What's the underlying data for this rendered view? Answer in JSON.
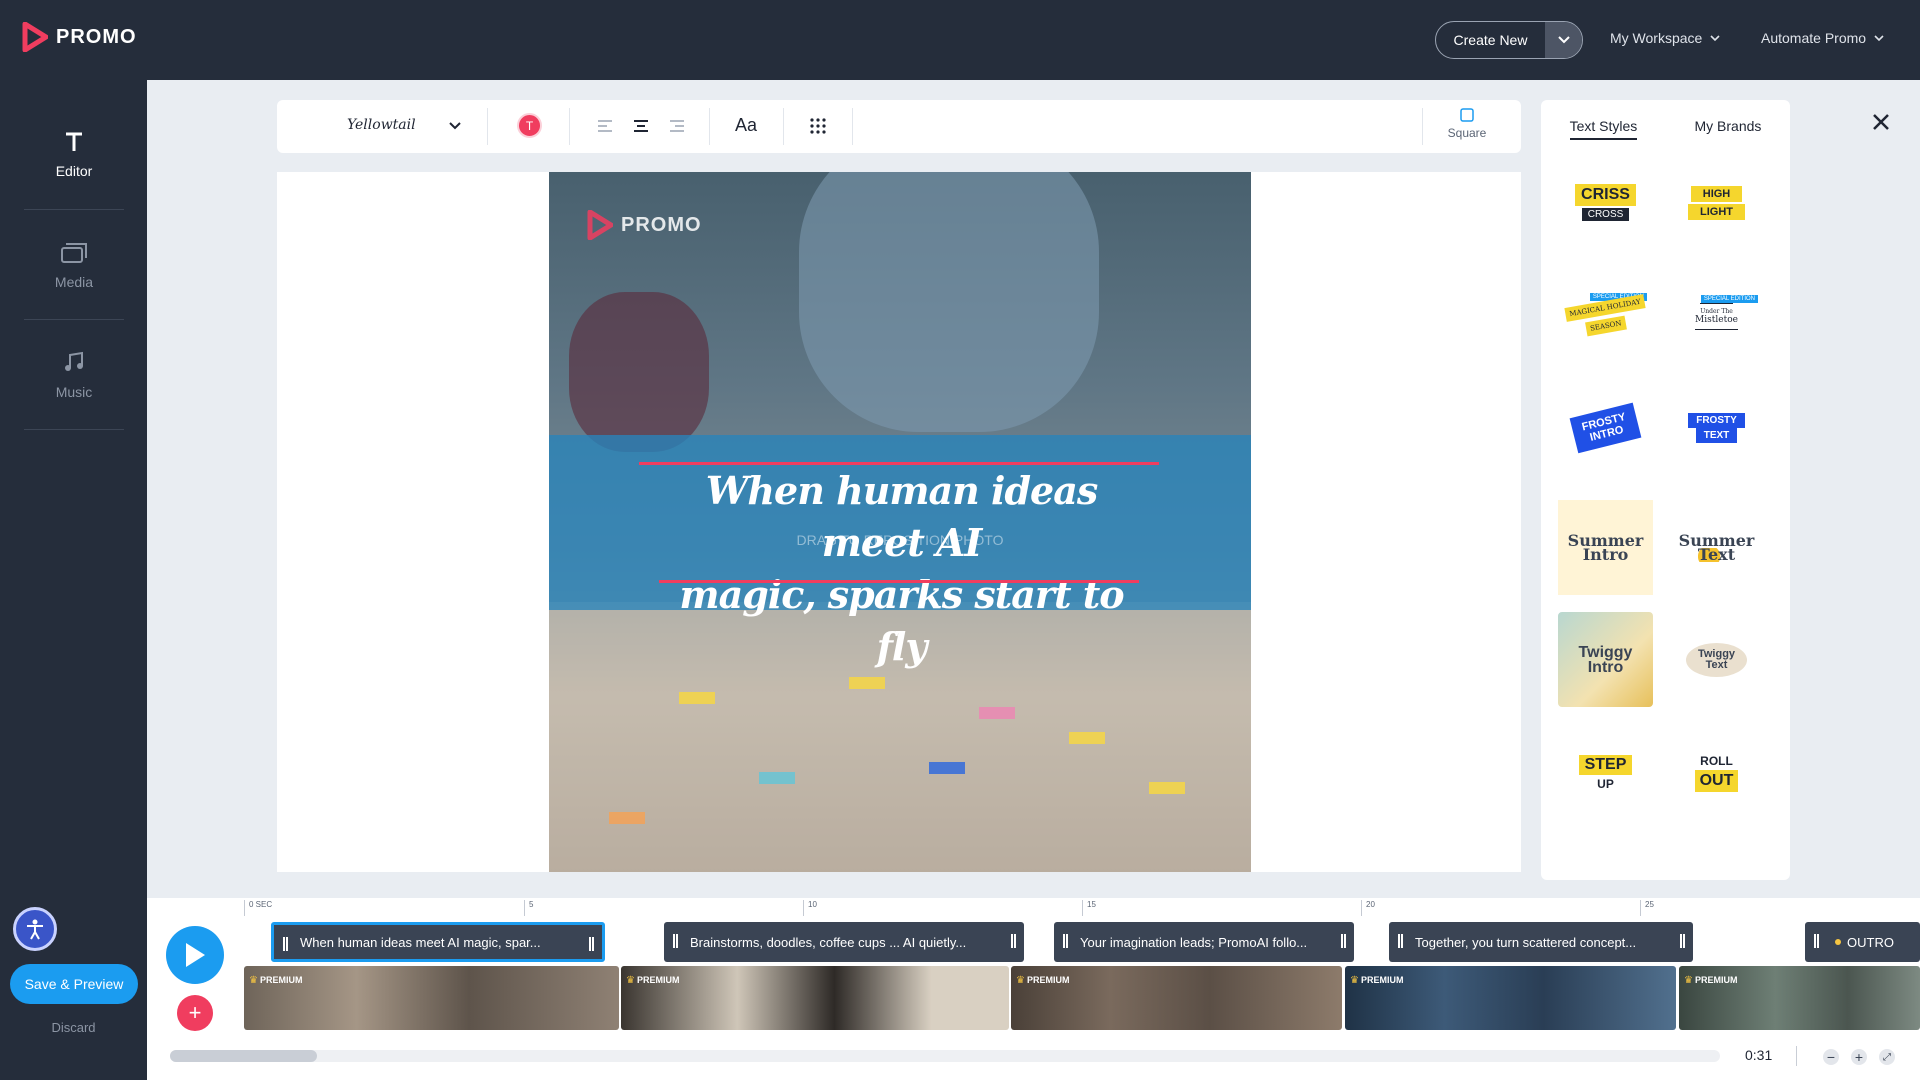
{
  "app": {
    "logo_text": "PROMO"
  },
  "header": {
    "create_new": "Create New",
    "my_workspace": "My Workspace",
    "automate": "Automate Promo"
  },
  "sidebar": {
    "items": [
      {
        "label": "Editor"
      },
      {
        "label": "Media"
      },
      {
        "label": "Music"
      }
    ],
    "save_preview": "Save & Preview",
    "discard": "Discard"
  },
  "toolbar": {
    "font": "Yellowtail",
    "color_letter": "T",
    "case_label": "Aa",
    "aspect_label": "Square"
  },
  "canvas": {
    "logo_text": "PROMO",
    "caption_line1": "When human ideas meet AI",
    "caption_line2": "magic, sparks start to fly",
    "drag_hint": "DRAG TO REPOSITION PHOTO"
  },
  "right_panel": {
    "tabs": [
      "Text Styles",
      "My Brands"
    ],
    "styles": [
      {
        "top": "CRISS",
        "bottom": "CROSS"
      },
      {
        "top": "HIGH",
        "bottom": "LIGHT"
      },
      {
        "top": "MAGICAL HOLIDAY",
        "bottom": "SEASON",
        "tag": "SPECIAL EDITION"
      },
      {
        "top": "Under The",
        "bottom": "Mistletoe",
        "tag": "SPECIAL EDITION"
      },
      {
        "top": "FROSTY",
        "bottom": "INTRO"
      },
      {
        "top": "FROSTY",
        "bottom": "TEXT"
      },
      {
        "top": "Summer",
        "bottom": "Intro"
      },
      {
        "top": "Summer",
        "bottom": "Text"
      },
      {
        "top": "Twiggy",
        "bottom": "Intro"
      },
      {
        "top": "Twiggy",
        "bottom": "Text"
      },
      {
        "top": "STEP",
        "bottom": "UP"
      },
      {
        "top": "ROLL",
        "bottom": "OUT"
      }
    ]
  },
  "timeline": {
    "ticks": [
      "0 SEC",
      "5",
      "10",
      "15",
      "20",
      "25"
    ],
    "text_clips": [
      "When human ideas meet AI magic, spar...",
      "Brainstorms, doodles, coffee cups ... AI quietly...",
      "Your imagination leads; PromoAI follo...",
      "Together, you turn scattered concept...",
      "OUTRO"
    ],
    "premium_label": "PREMIUM",
    "time": "0:31"
  },
  "colors": {
    "accent": "#1b9cf0",
    "brand_red": "#f03d5f",
    "dark": "#252d3b"
  }
}
